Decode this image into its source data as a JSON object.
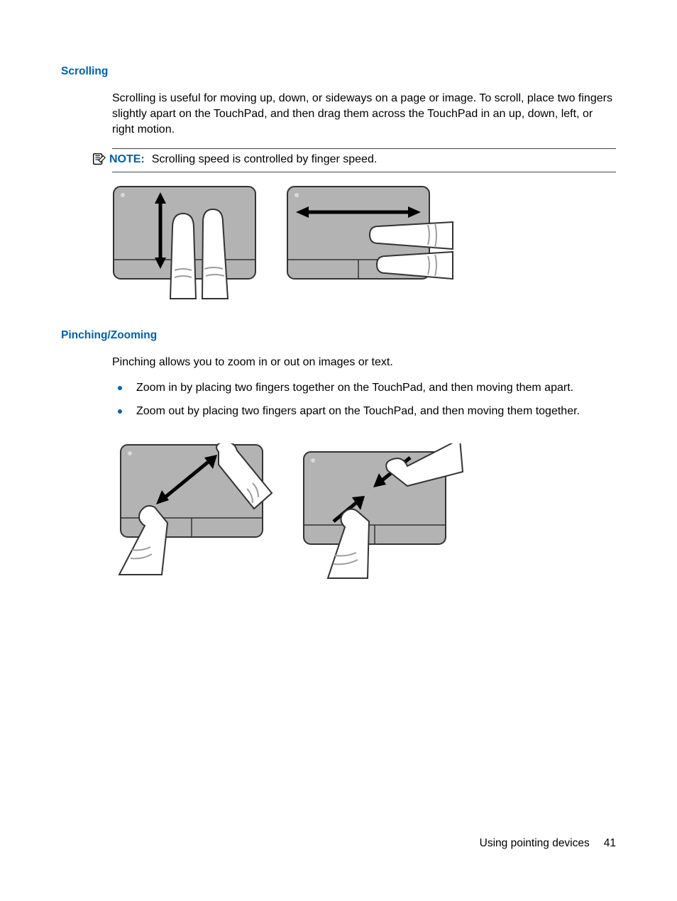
{
  "sections": {
    "scrolling": {
      "heading": "Scrolling",
      "paragraph": "Scrolling is useful for moving up, down, or sideways on a page or image. To scroll, place two fingers slightly apart on the TouchPad, and then drag them across the TouchPad in an up, down, left, or right motion.",
      "note": {
        "label": "NOTE:",
        "text": "Scrolling speed is controlled by finger speed."
      }
    },
    "pinching": {
      "heading": "Pinching/Zooming",
      "paragraph": "Pinching allows you to zoom in or out on images or text.",
      "bullets": [
        "Zoom in by placing two fingers together on the TouchPad, and then moving them apart.",
        "Zoom out by placing two fingers apart on the TouchPad, and then moving them together."
      ]
    }
  },
  "footer": {
    "section_title": "Using pointing devices",
    "page_number": "41"
  }
}
